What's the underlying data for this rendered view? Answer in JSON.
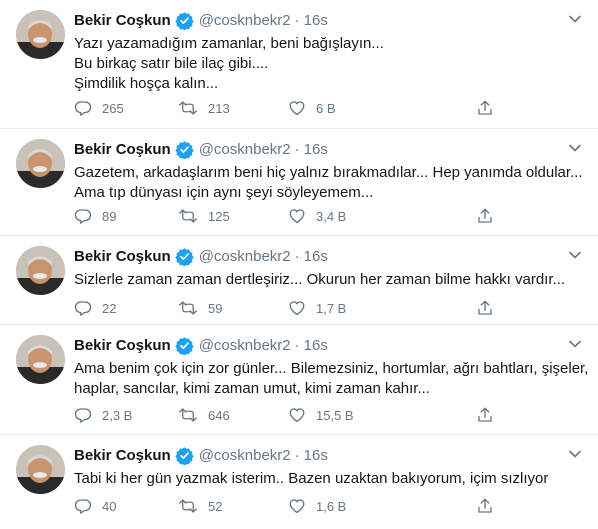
{
  "tweets": [
    {
      "name": "Bekir Coşkun",
      "handle": "@cosknbekr2",
      "separator": "·",
      "time": "16s",
      "lines": [
        "Yazı yazamadığım zamanlar, beni bağışlayın...",
        "Bu birkaç satır bile ilaç gibi....",
        "Şimdilik hoşça kalın..."
      ],
      "replies": "265",
      "retweets": "213",
      "likes": "6 B"
    },
    {
      "name": "Bekir Coşkun",
      "handle": "@cosknbekr2",
      "separator": "·",
      "time": "16s",
      "lines": [
        "Gazetem, arkadaşlarım beni hiç yalnız bırakmadılar... Hep yanımda oldular...",
        "Ama tıp dünyası için aynı şeyi söyleyemem..."
      ],
      "replies": "89",
      "retweets": "125",
      "likes": "3,4 B"
    },
    {
      "name": "Bekir Coşkun",
      "handle": "@cosknbekr2",
      "separator": "·",
      "time": "16s",
      "lines": [
        "Sizlerle zaman zaman dertleşiriz... Okurun her zaman bilme hakkı vardır..."
      ],
      "replies": "22",
      "retweets": "59",
      "likes": "1,7 B"
    },
    {
      "name": "Bekir Coşkun",
      "handle": "@cosknbekr2",
      "separator": "·",
      "time": "16s",
      "lines": [
        "Ama benim çok için zor günler... Bilemezsiniz, hortumlar, ağrı bahtları, şişeler,",
        "haplar, sancılar, kimi zaman umut, kimi zaman kahır..."
      ],
      "replies": "2,3 B",
      "retweets": "646",
      "likes": "15,5 B"
    },
    {
      "name": "Bekir Coşkun",
      "handle": "@cosknbekr2",
      "separator": "·",
      "time": "16s",
      "lines": [
        "Tabi ki her gün yazmak isterim.. Bazen uzaktan bakıyorum, içim sızlıyor"
      ],
      "replies": "40",
      "retweets": "52",
      "likes": "1,6 B"
    }
  ],
  "colors": {
    "text": "#14171a",
    "secondary": "#657786",
    "verified": "#1da1f2",
    "divider": "#e6ecf0"
  },
  "icons": [
    "verified-badge-icon",
    "chevron-down-icon",
    "reply-icon",
    "retweet-icon",
    "like-icon",
    "share-icon"
  ]
}
